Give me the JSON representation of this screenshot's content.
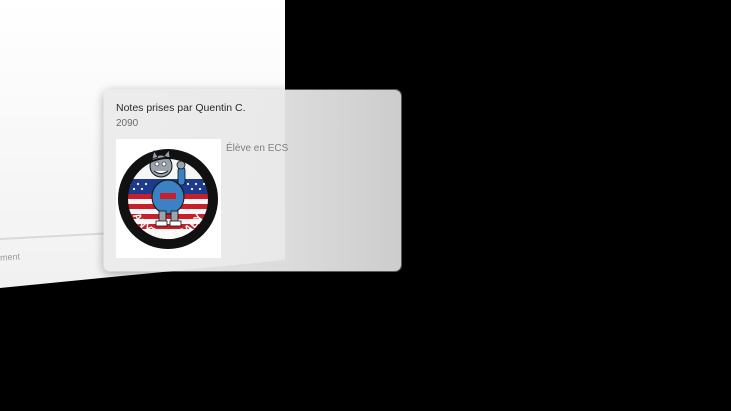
{
  "background": {
    "label": "ment"
  },
  "card": {
    "title": "Notes prises par Quentin C.",
    "year": "2090",
    "description": "Élève en ECS",
    "patch": {
      "icon": "anytime-baby-tomcat-patch",
      "text": "ANYTIME BABY"
    }
  },
  "colors": {
    "background": "#000000",
    "card": "#e8e8e8",
    "patch_red": "#c8202a",
    "patch_blue": "#1e3a8a"
  }
}
